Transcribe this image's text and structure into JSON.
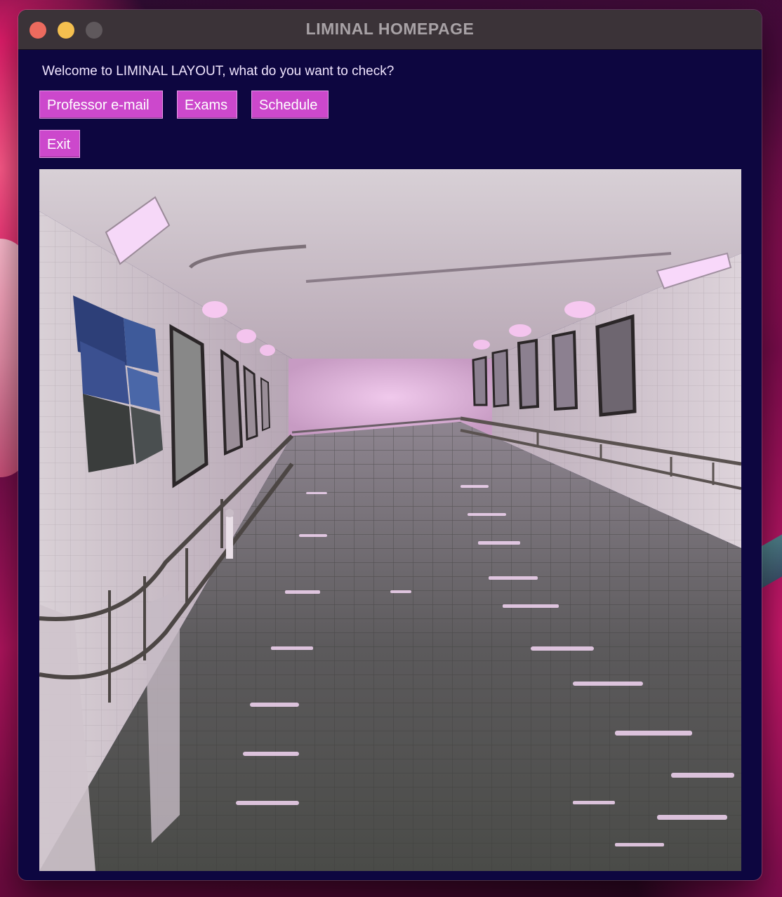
{
  "window": {
    "title": "LIMINAL HOMEPAGE"
  },
  "main": {
    "welcome_text": "Welcome to LIMINAL LAYOUT, what do you want to check?",
    "buttons": {
      "professor_email": "Professor e-mail",
      "exams": "Exams",
      "schedule": "Schedule",
      "exit": "Exit"
    }
  },
  "image": {
    "subject": "flooded-tiled-underpass-tunnel-pink-tint"
  },
  "colors": {
    "window_bg": "#0d0640",
    "titlebar_bg": "#3b3338",
    "button_bg": "#cc48cc",
    "button_text": "#ffffff",
    "welcome_text": "#f1e6ff",
    "traffic_close": "#ec6a5e",
    "traffic_minimize": "#f4bf4f",
    "traffic_maximize": "#5f585c"
  }
}
